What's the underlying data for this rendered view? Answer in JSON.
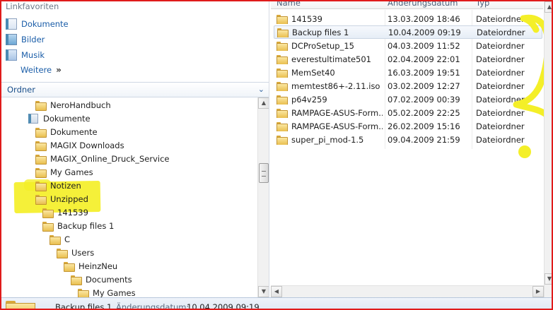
{
  "favorites": {
    "title": "Linkfavoriten",
    "items": [
      {
        "label": "Dokumente",
        "icon": "documents-library-icon"
      },
      {
        "label": "Bilder",
        "icon": "pictures-library-icon"
      },
      {
        "label": "Musik",
        "icon": "music-library-icon"
      }
    ],
    "more_label": "Weitere",
    "more_glyph": "»"
  },
  "folders_header": {
    "label": "Ordner",
    "arrow": "⌄"
  },
  "tree": [
    {
      "label": "NeroHandbuch",
      "icon": "folder-icon"
    },
    {
      "label": "Dokumente",
      "icon": "documents-library-icon"
    },
    {
      "label": "Dokumente",
      "icon": "folder-icon"
    },
    {
      "label": "MAGIX Downloads",
      "icon": "folder-icon"
    },
    {
      "label": "MAGIX_Online_Druck_Service",
      "icon": "folder-icon"
    },
    {
      "label": "My Games",
      "icon": "folder-icon"
    },
    {
      "label": "Notizen",
      "icon": "folder-icon"
    },
    {
      "label": "Unzipped",
      "icon": "folder-icon"
    },
    {
      "label": "141539",
      "icon": "folder-icon"
    },
    {
      "label": "Backup files 1",
      "icon": "folder-icon"
    },
    {
      "label": "C",
      "icon": "folder-icon"
    },
    {
      "label": "Users",
      "icon": "folder-icon"
    },
    {
      "label": "HeinzNeu",
      "icon": "folder-icon"
    },
    {
      "label": "Documents",
      "icon": "folder-icon"
    },
    {
      "label": "My Games",
      "icon": "folder-icon"
    }
  ],
  "columns": {
    "name": "Name",
    "date": "Änderungsdatum",
    "type": "Typ"
  },
  "files": [
    {
      "name": "141539",
      "date": "13.03.2009 18:46",
      "type": "Dateiordner"
    },
    {
      "name": "Backup files 1",
      "date": "10.04.2009 09:19",
      "type": "Dateiordner",
      "selected": true
    },
    {
      "name": "DCProSetup_15",
      "date": "04.03.2009 11:52",
      "type": "Dateiordner"
    },
    {
      "name": "everestultimate501",
      "date": "02.04.2009 22:01",
      "type": "Dateiordner"
    },
    {
      "name": "MemSet40",
      "date": "16.03.2009 19:51",
      "type": "Dateiordner"
    },
    {
      "name": "memtest86+-2.11.iso",
      "date": "03.02.2009 12:27",
      "type": "Dateiordner"
    },
    {
      "name": "p64v259",
      "date": "07.02.2009 00:39",
      "type": "Dateiordner"
    },
    {
      "name": "RAMPAGE-ASUS-Form...",
      "date": "05.02.2009 22:25",
      "type": "Dateiordner"
    },
    {
      "name": "RAMPAGE-ASUS-Form...",
      "date": "26.02.2009 15:16",
      "type": "Dateiordner"
    },
    {
      "name": "super_pi_mod-1.5",
      "date": "09.04.2009 21:59",
      "type": "Dateiordner"
    }
  ],
  "status": {
    "name": "Backup files 1",
    "date_label": "Änderungsdatum:",
    "date_value": "10.04.2009 09:19"
  },
  "scroll_glyphs": {
    "up": "▲",
    "down": "▼",
    "left": "◀",
    "right": "▶"
  },
  "colors": {
    "highlight": "#f4ef28",
    "frame": "#e01b1b",
    "link": "#1a5da8"
  }
}
